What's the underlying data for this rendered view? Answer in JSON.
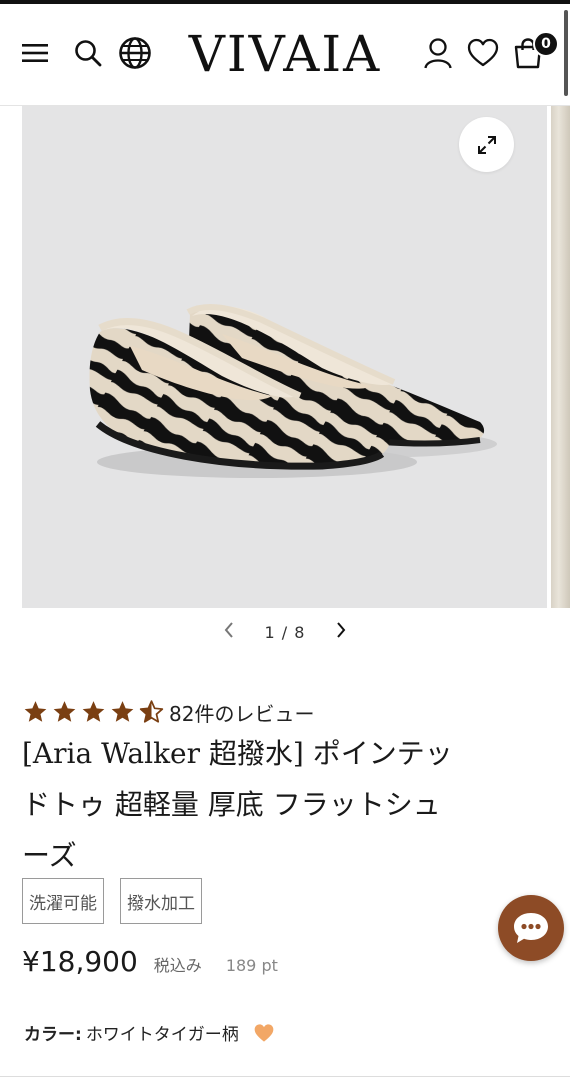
{
  "header": {
    "logo": "VIVAIA",
    "cart_count": "0",
    "icons": [
      "menu-icon",
      "search-icon",
      "globe-icon",
      "account-icon",
      "wishlist-heart-icon",
      "cart-bag-icon"
    ]
  },
  "gallery": {
    "pager_text": "1 / 8",
    "current_index": 1,
    "total": 8
  },
  "product": {
    "rating_value": 4.5,
    "review_count": "82件のレビュー",
    "title_lines": [
      "[Aria Walker 超撥水] ポインテッ",
      "ドトゥ 超軽量 厚底 フラットシュ",
      "ーズ"
    ],
    "tags": [
      "洗濯可能",
      "撥水加工"
    ],
    "price": "¥18,900",
    "tax_label": "税込み",
    "points": "189 pt",
    "color_label": "カラー:",
    "color_value": "ホワイトタイガー柄"
  },
  "colors": {
    "star": "#7a3f12",
    "chat_button": "#8d4b26",
    "heart": "#f2a766"
  }
}
